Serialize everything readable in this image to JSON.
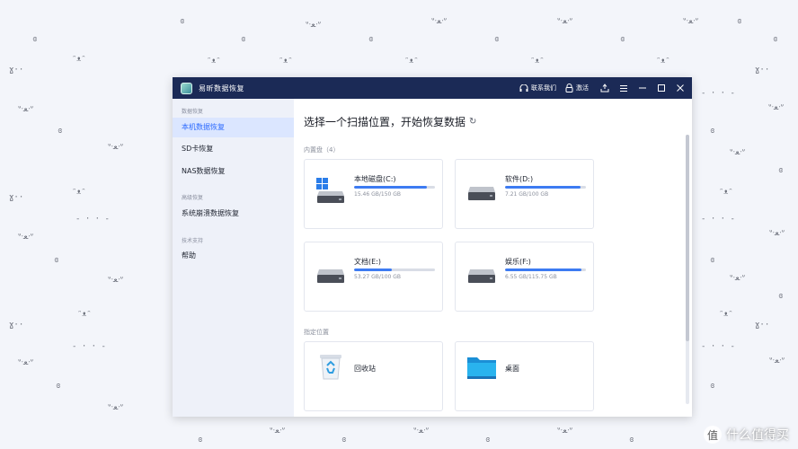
{
  "window": {
    "title": "易昕数据恢复",
    "contact_label": "联系我们",
    "activate_label": "激活"
  },
  "sidebar": {
    "groups": [
      {
        "label": "数据恢复",
        "items": [
          "本机数据恢复",
          "SD卡恢复",
          "NAS数据恢复"
        ]
      },
      {
        "label": "高级恢复",
        "items": [
          "系统崩溃数据恢复"
        ]
      },
      {
        "label": "技术支持",
        "items": [
          "帮助"
        ]
      }
    ],
    "active_item": "本机数据恢复"
  },
  "main": {
    "title": "选择一个扫描位置，开始恢复数据",
    "disks_section_label": "内置盘（4）",
    "locations_section_label": "指定位置",
    "disks": [
      {
        "name": "本地磁盘(C:)",
        "size": "15.46 GB/150 GB",
        "used_fraction": 0.9,
        "icon": "windows-drive-icon"
      },
      {
        "name": "软件(D:)",
        "size": "7.21 GB/100 GB",
        "used_fraction": 0.93,
        "icon": "hard-drive-icon"
      },
      {
        "name": "文档(E:)",
        "size": "53.27 GB/100 GB",
        "used_fraction": 0.47,
        "icon": "hard-drive-icon"
      },
      {
        "name": "娱乐(F:)",
        "size": "6.55 GB/115.75 GB",
        "used_fraction": 0.94,
        "icon": "hard-drive-icon"
      }
    ],
    "locations": [
      {
        "name": "回收站",
        "icon": "recycle-bin-icon"
      },
      {
        "name": "桌面",
        "icon": "desktop-folder-icon"
      }
    ]
  },
  "watermark": {
    "text": "什么值得买",
    "badge": "值"
  },
  "colors": {
    "titlebar": "#1b2a56",
    "accent": "#2d6bff",
    "bar_fill": "#3d7bf2",
    "sidebar_bg": "#eef1f9"
  }
}
